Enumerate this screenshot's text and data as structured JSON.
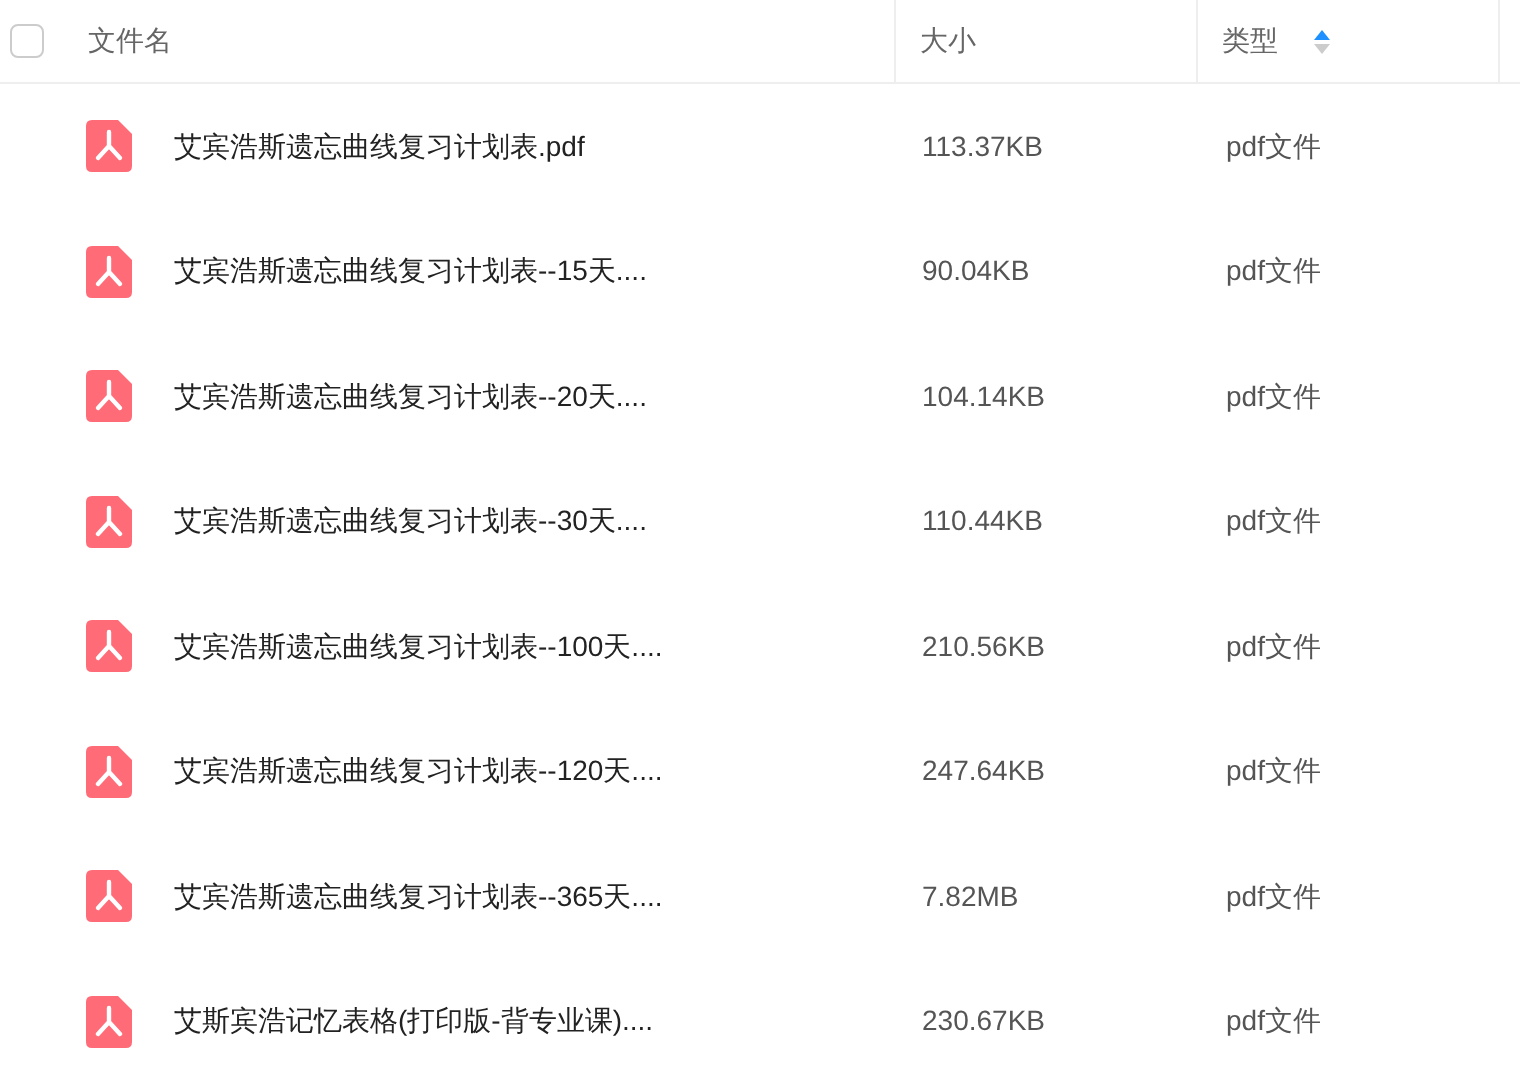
{
  "header": {
    "select_all": {
      "checked": false
    },
    "columns": [
      {
        "label": "文件名"
      },
      {
        "label": "大小"
      },
      {
        "label": "类型",
        "sorted_ascending": true
      }
    ]
  },
  "rows": [
    {
      "name": "艾宾浩斯遗忘曲线复习计划表.pdf",
      "size": "113.37KB",
      "type": "pdf文件"
    },
    {
      "name": "艾宾浩斯遗忘曲线复习计划表--15天....",
      "size": "90.04KB",
      "type": "pdf文件"
    },
    {
      "name": "艾宾浩斯遗忘曲线复习计划表--20天....",
      "size": "104.14KB",
      "type": "pdf文件"
    },
    {
      "name": "艾宾浩斯遗忘曲线复习计划表--30天....",
      "size": "110.44KB",
      "type": "pdf文件"
    },
    {
      "name": "艾宾浩斯遗忘曲线复习计划表--100天....",
      "size": "210.56KB",
      "type": "pdf文件"
    },
    {
      "name": "艾宾浩斯遗忘曲线复习计划表--120天....",
      "size": "247.64KB",
      "type": "pdf文件"
    },
    {
      "name": "艾宾浩斯遗忘曲线复习计划表--365天....",
      "size": "7.82MB",
      "type": "pdf文件"
    },
    {
      "name": "艾斯宾浩记忆表格(打印版-背专业课)....",
      "size": "230.67KB",
      "type": "pdf文件"
    }
  ]
}
